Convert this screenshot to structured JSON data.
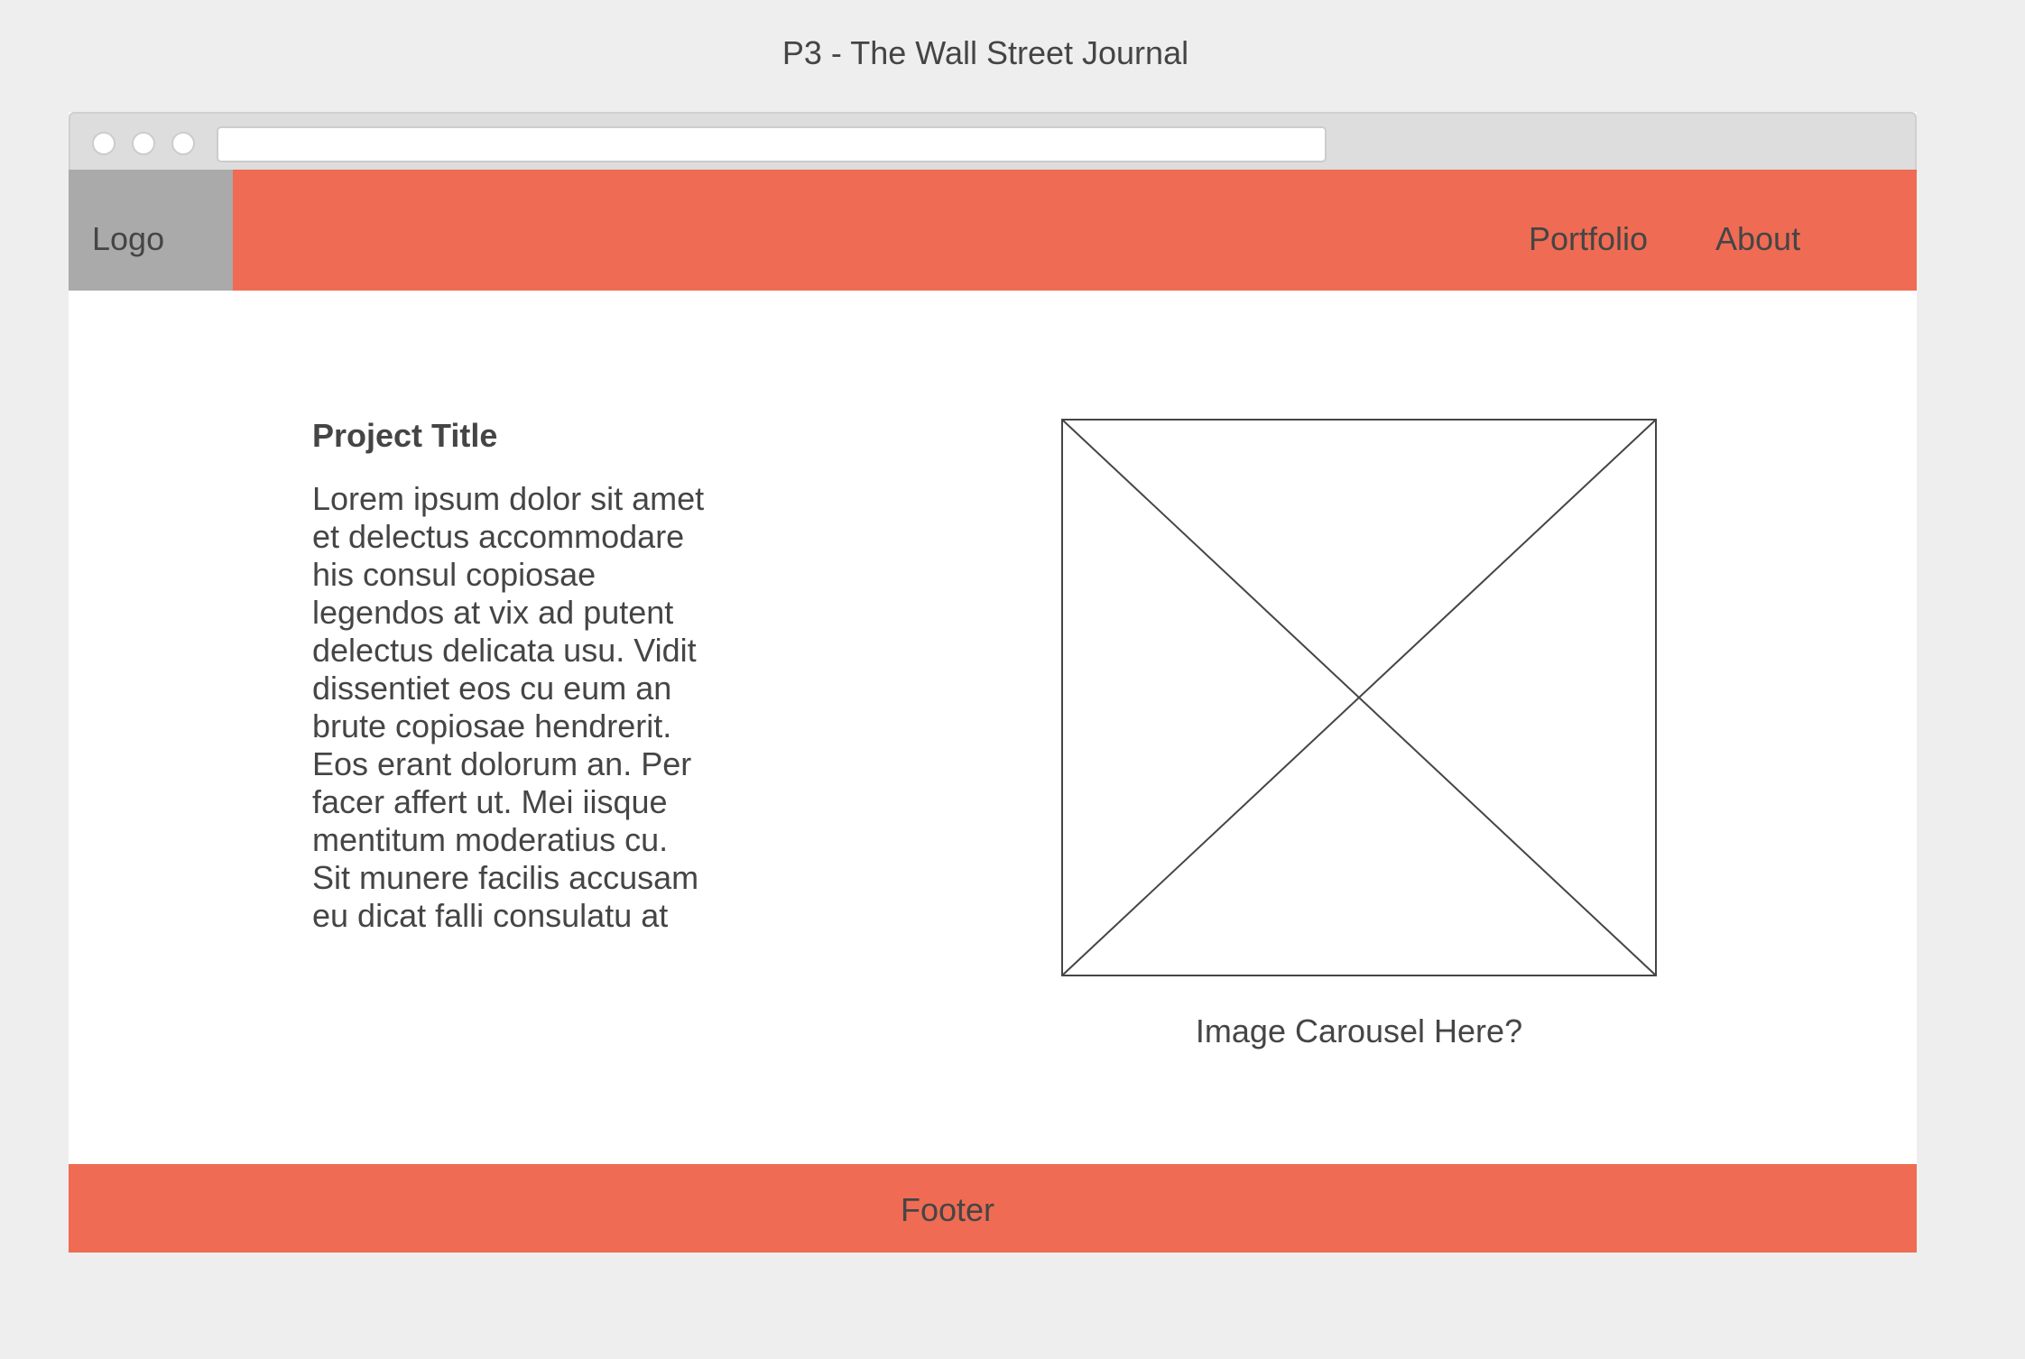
{
  "window": {
    "title": "P3 - The Wall Street Journal"
  },
  "browser": {
    "address": ""
  },
  "navbar": {
    "logo": "Logo",
    "links": [
      {
        "label": "Portfolio"
      },
      {
        "label": "About"
      }
    ]
  },
  "content": {
    "title": "Project Title",
    "body": "Lorem ipsum dolor sit amet et delectus accommodare his consul copiosae legendos at vix ad putent delectus delicata usu. Vidit dissentiet eos cu eum an brute copiosae hendrerit. Eos erant dolorum an. Per facer affert ut. Mei iisque mentitum moderatius cu. Sit munere facilis accusam eu dicat falli consulatu at",
    "image_caption": "Image Carousel Here?"
  },
  "footer": {
    "label": "Footer"
  },
  "colors": {
    "accent": "#ef6b53",
    "logo_bg": "#aaaaaa",
    "page_bg": "#eeeeee",
    "chrome_bg": "#dddddd",
    "text": "#454545"
  }
}
